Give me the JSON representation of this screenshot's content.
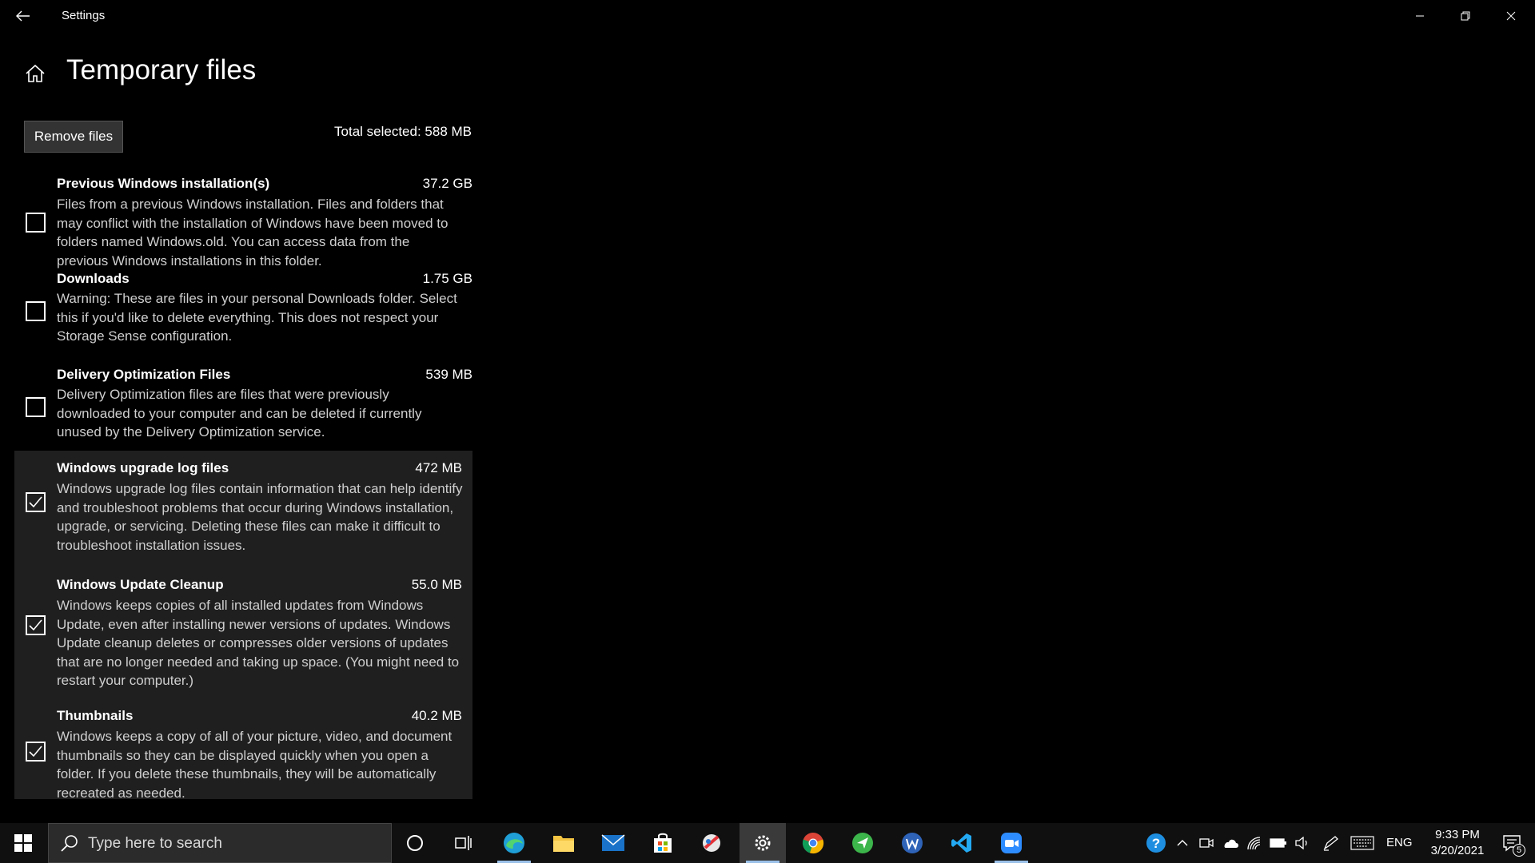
{
  "window": {
    "title": "Settings"
  },
  "page": {
    "title": "Temporary files",
    "remove_button": "Remove files",
    "total_selected": "Total selected: 588 MB"
  },
  "items": [
    {
      "name": "Previous Windows installation(s)",
      "size": "37.2 GB",
      "checked": false,
      "desc": "Files from a previous Windows installation.  Files and folders that may conflict with the installation of Windows have been moved to folders named Windows.old.  You can access data from the previous Windows installations in this folder."
    },
    {
      "name": "Downloads",
      "size": "1.75 GB",
      "checked": false,
      "desc": "Warning: These are files in your personal Downloads folder. Select this if you'd like to delete everything. This does not respect your Storage Sense configuration."
    },
    {
      "name": "Delivery Optimization Files",
      "size": "539 MB",
      "checked": false,
      "desc": "Delivery Optimization files are files that were previously downloaded to your computer and can be deleted if currently unused by the Delivery Optimization service."
    },
    {
      "name": "Windows upgrade log files",
      "size": "472 MB",
      "checked": true,
      "desc": "Windows upgrade log files contain information that can help identify and troubleshoot problems that occur during Windows installation, upgrade, or servicing.  Deleting these files can make it difficult to troubleshoot installation issues."
    },
    {
      "name": "Windows Update Cleanup",
      "size": "55.0 MB",
      "checked": true,
      "desc": "Windows keeps copies of all installed updates from Windows Update, even after installing newer versions of updates. Windows Update cleanup deletes or compresses older versions of updates that are no longer needed and taking up space. (You might need to restart your computer.)"
    },
    {
      "name": "Thumbnails",
      "size": "40.2 MB",
      "checked": true,
      "desc": "Windows keeps a copy of all of your picture, video, and document thumbnails so they can be displayed quickly when you open a folder. If you delete these thumbnails, they will be automatically recreated as needed."
    }
  ],
  "taskbar": {
    "search_placeholder": "Type here to search",
    "language": "ENG",
    "time": "9:33 PM",
    "date": "3/20/2021",
    "notification_count": "5",
    "apps": [
      "cortana-icon",
      "task-view-icon",
      "edge-icon",
      "file-explorer-icon",
      "mail-icon",
      "store-icon",
      "snip-sketch-icon",
      "settings-icon",
      "chrome-icon",
      "vpn-app-icon",
      "word-app-icon",
      "vscode-icon",
      "zoom-icon"
    ]
  },
  "colors": {
    "background": "#000000",
    "item_highlight": "#1f1f1f",
    "taskbar": "#101010",
    "button": "#333333"
  }
}
